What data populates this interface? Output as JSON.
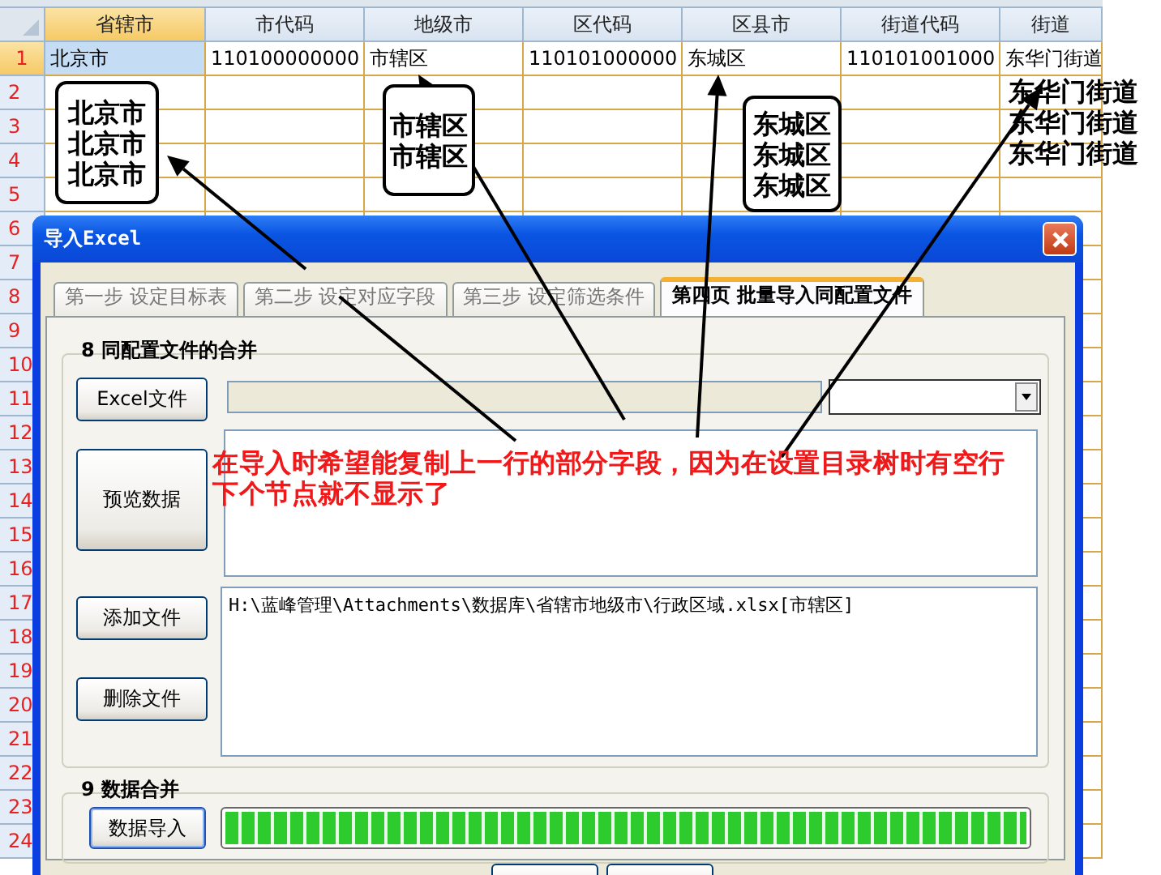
{
  "spreadsheet": {
    "columns": [
      {
        "label": "省辖市",
        "selected": true
      },
      {
        "label": "市代码",
        "selected": false
      },
      {
        "label": "地级市",
        "selected": false
      },
      {
        "label": "区代码",
        "selected": false
      },
      {
        "label": "区县市",
        "selected": false
      },
      {
        "label": "街道代码",
        "selected": false
      },
      {
        "label": "街道",
        "selected": false
      }
    ],
    "rows": [
      {
        "number": "1",
        "selected": true,
        "cells": [
          "北京市",
          "110100000000",
          "市辖区",
          "110101000000",
          "东城区",
          "110101001000",
          "东华门街道"
        ]
      },
      {
        "number": "2",
        "selected": false
      },
      {
        "number": "3",
        "selected": false
      },
      {
        "number": "4",
        "selected": false
      },
      {
        "number": "5",
        "selected": false
      },
      {
        "number": "6",
        "selected": false
      },
      {
        "number": "7",
        "selected": false
      },
      {
        "number": "8",
        "selected": false
      },
      {
        "number": "9",
        "selected": false
      },
      {
        "number": "10",
        "selected": false
      },
      {
        "number": "11",
        "selected": false
      },
      {
        "number": "12",
        "selected": false
      },
      {
        "number": "13",
        "selected": false
      },
      {
        "number": "14",
        "selected": false
      },
      {
        "number": "15",
        "selected": false
      },
      {
        "number": "16",
        "selected": false
      },
      {
        "number": "17",
        "selected": false
      },
      {
        "number": "18",
        "selected": false
      },
      {
        "number": "19",
        "selected": false
      },
      {
        "number": "20",
        "selected": false
      },
      {
        "number": "21",
        "selected": false
      },
      {
        "number": "22",
        "selected": false
      },
      {
        "number": "23",
        "selected": false
      },
      {
        "number": "24",
        "selected": false
      }
    ]
  },
  "dialog": {
    "title": "导入Excel",
    "tabs": [
      {
        "label": "第一步  设定目标表",
        "selected": false
      },
      {
        "label": "第二步  设定对应字段",
        "selected": false
      },
      {
        "label": "第三步  设定筛选条件",
        "selected": false
      },
      {
        "label": "第四页 批量导入同配置文件",
        "selected": true
      }
    ],
    "file_group": {
      "title": "8  同配置文件的合并",
      "buttons": [
        "Excel文件",
        "预览数据",
        "添加文件",
        "删除文件"
      ],
      "files": [
        "H:\\蓝峰管理\\Attachments\\数据库\\省辖市地级市\\行政区域.xlsx[市辖区]"
      ]
    },
    "merge_group": {
      "title": "9  数据合并",
      "button": "数据导入",
      "progress": {
        "level": 1.0
      }
    }
  },
  "annotations": {
    "callouts": [
      {
        "boxed": true,
        "lines": [
          "北京市",
          "北京市",
          "北京市"
        ]
      },
      {
        "boxed": true,
        "lines": [
          "市辖区",
          "市辖区"
        ]
      },
      {
        "boxed": true,
        "lines": [
          "东城区",
          "东城区",
          "东城区"
        ]
      },
      {
        "boxed": false,
        "lines": [
          "东华门街道",
          "东华门街道",
          "东华门街道"
        ]
      }
    ],
    "note": "在导入时希望能复制上一行的部分字段，因为在设置目录树时有空行下个节点就不显示了"
  }
}
